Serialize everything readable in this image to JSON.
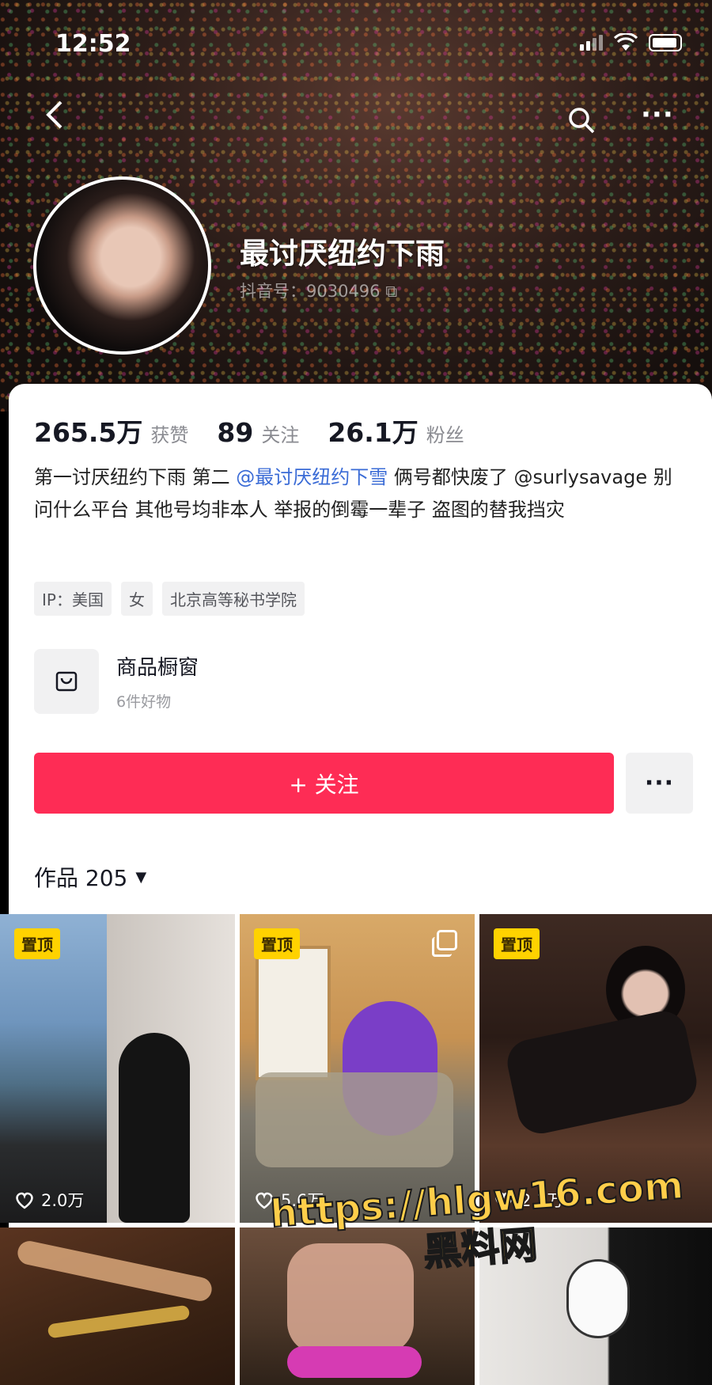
{
  "status": {
    "time": "12:52"
  },
  "profile": {
    "nickname": "最讨厌纽约下雨",
    "uid": "抖音号：9030496 ⧉",
    "stats": [
      {
        "num": "265.5万",
        "label": "获赞"
      },
      {
        "num": "89",
        "label": "关注"
      },
      {
        "num": "26.1万",
        "label": "粉丝"
      }
    ],
    "bio": {
      "part1": "第一讨厌纽约下雨 第二 ",
      "mention": "@最讨厌纽约下雪",
      "part2": " 俩号都快废了 @surlysavage 别问什么平台 其他号均非本人 举报的倒霉一辈子 盗图的替我挡灾"
    },
    "tags": [
      "IP：美国",
      "女",
      "北京高等秘书学院"
    ],
    "shop": {
      "title": "商品橱窗",
      "subtitle": "6件好物"
    },
    "follow_label": "+ 关注",
    "more_label": "···",
    "works_label": "作品 205",
    "works_caret": "▼"
  },
  "grid": {
    "pin_label": "置顶",
    "items": [
      {
        "likes": "2.0万",
        "pinned": true
      },
      {
        "likes": "5.6万",
        "pinned": true
      },
      {
        "likes": "2.3万",
        "pinned": true
      },
      {
        "likes": ""
      },
      {
        "likes": ""
      },
      {
        "likes": ""
      }
    ]
  },
  "watermark": {
    "url": "https://hlgw16.com",
    "name": "黑料网"
  },
  "colors": {
    "accent": "#fe2c55",
    "mention": "#3a6bd6",
    "pin": "#ffd200"
  }
}
